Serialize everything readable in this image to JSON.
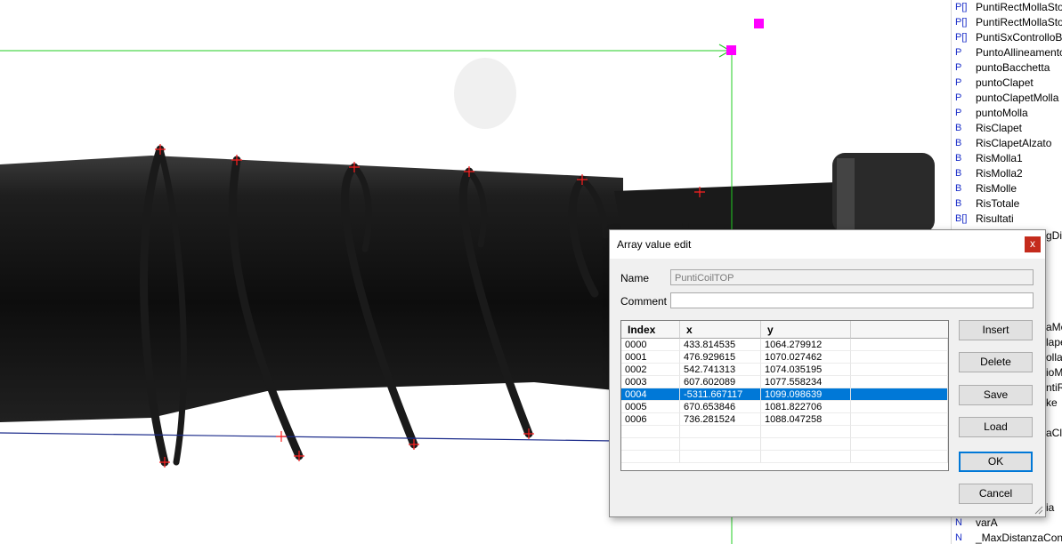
{
  "variables": [
    {
      "type": "P[]",
      "name": "PuntiRectMollaSto"
    },
    {
      "type": "P[]",
      "name": "PuntiRectMollaSto"
    },
    {
      "type": "P[]",
      "name": "PuntiSxControlloBa"
    },
    {
      "type": "P",
      "name": "PuntoAllineamento"
    },
    {
      "type": "P",
      "name": "puntoBacchetta"
    },
    {
      "type": "P",
      "name": "puntoClapet"
    },
    {
      "type": "P",
      "name": "puntoClapetMolla"
    },
    {
      "type": "P",
      "name": "puntoMolla"
    },
    {
      "type": "B",
      "name": "RisClapet"
    },
    {
      "type": "B",
      "name": "RisClapetAlzato"
    },
    {
      "type": "B",
      "name": "RisMolla1"
    },
    {
      "type": "B",
      "name": "RisMolla2"
    },
    {
      "type": "B",
      "name": "RisMolle"
    },
    {
      "type": "B",
      "name": "RisTotale"
    },
    {
      "type": "B[]",
      "name": "Risultati"
    }
  ],
  "variables_partial": [
    {
      "text": "gDis"
    },
    {
      "text": "aMo"
    },
    {
      "text": "lapet"
    },
    {
      "text": "olla"
    },
    {
      "text": "ioM"
    },
    {
      "text": "ntiRa"
    },
    {
      "text": "ke"
    },
    {
      "text": "aCla"
    },
    {
      "text": "ia"
    }
  ],
  "variables_bottom": [
    {
      "type": "N",
      "name": "varA"
    },
    {
      "type": "N",
      "name": "_MaxDistanzaCont"
    }
  ],
  "dialog": {
    "title": "Array value edit",
    "close_label": "x",
    "name_label": "Name",
    "name_value": "PuntiCoilTOP",
    "comment_label": "Comment",
    "comment_value": "",
    "columns": [
      "Index",
      "x",
      "y"
    ],
    "rows": [
      {
        "index": "0000",
        "x": "433.814535",
        "y": "1064.279912"
      },
      {
        "index": "0001",
        "x": "476.929615",
        "y": "1070.027462"
      },
      {
        "index": "0002",
        "x": "542.741313",
        "y": "1074.035195"
      },
      {
        "index": "0003",
        "x": "607.602089",
        "y": "1077.558234"
      },
      {
        "index": "0004",
        "x": "-5311.667117",
        "y": "1099.098639"
      },
      {
        "index": "0005",
        "x": "670.653846",
        "y": "1081.822706"
      },
      {
        "index": "0006",
        "x": "736.281524",
        "y": "1088.047258"
      }
    ],
    "selected_row": "0004",
    "buttons": {
      "insert": "Insert",
      "delete": "Delete",
      "save": "Save",
      "load": "Load",
      "ok": "OK",
      "cancel": "Cancel"
    }
  },
  "colors": {
    "guide_line": "#22cc22",
    "baseline": "#1a2a8a",
    "marker": "#ff00ff",
    "point_cross": "#ff2020",
    "selection": "#0078d7",
    "type_text": "#1a2ec8"
  }
}
